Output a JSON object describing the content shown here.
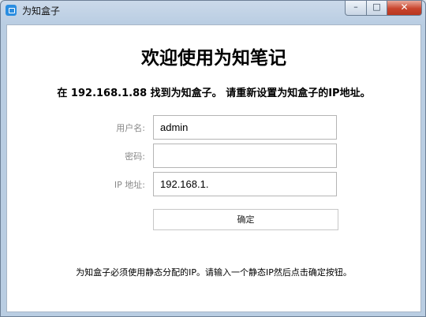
{
  "window": {
    "title": "为知盒子",
    "minimize_glyph": "–",
    "maximize_glyph": "□",
    "close_glyph": "✕"
  },
  "main": {
    "heading": "欢迎使用为知笔记",
    "subheading": "在 192.168.1.88 找到为知盒子。 请重新设置为知盒子的IP地址。",
    "username_label": "用户名:",
    "username_value": "admin",
    "password_label": "密码:",
    "password_value": "",
    "ip_label": "IP 地址:",
    "ip_value": "192.168.1.",
    "confirm_label": "确定",
    "footnote": "为知盒子必须使用静态分配的IP。请输入一个静态IP然后点击确定按钮。"
  },
  "colors": {
    "close_button": "#c8452d",
    "app_icon": "#2a8de0"
  }
}
